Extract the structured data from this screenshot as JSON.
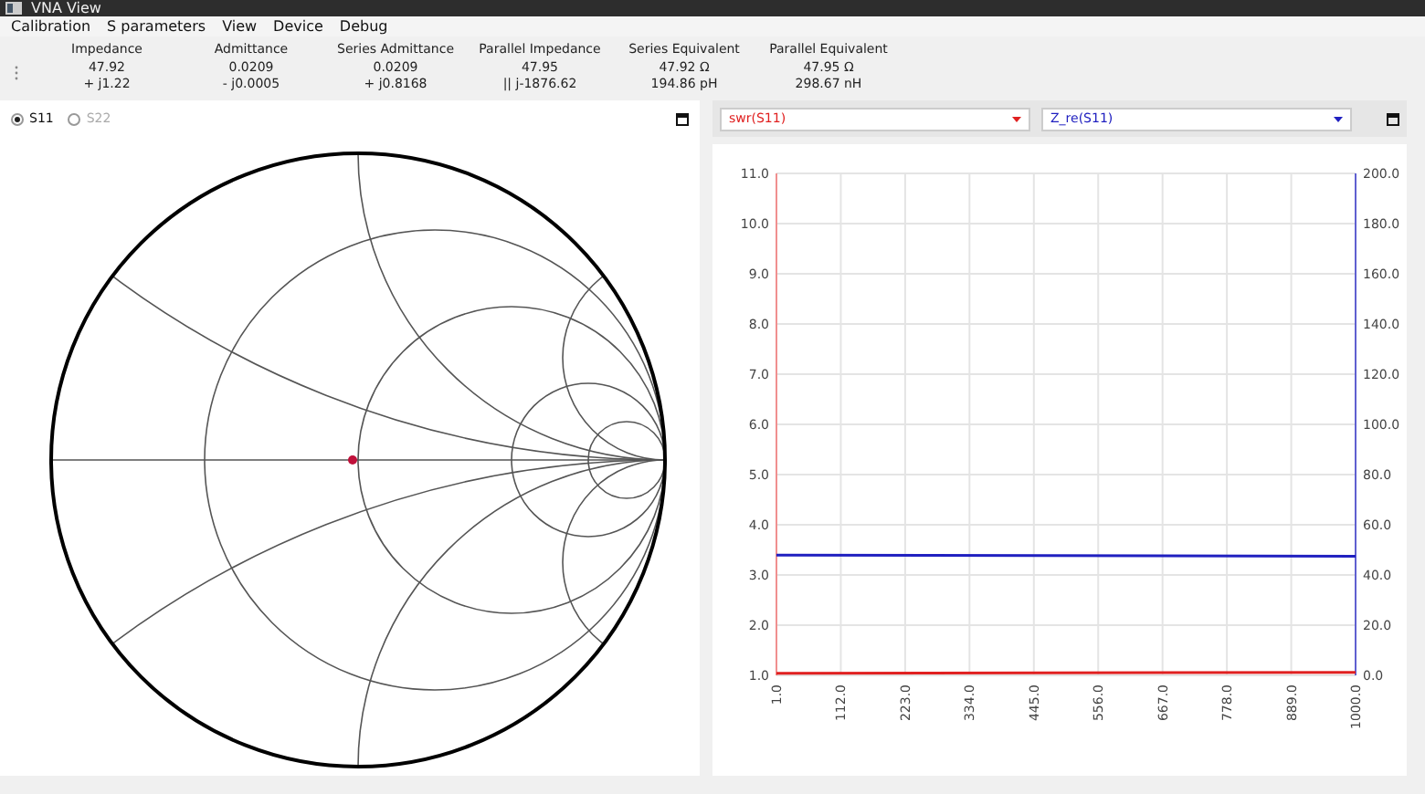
{
  "window": {
    "title": "VNA View"
  },
  "menu": [
    "Calibration",
    "S parameters",
    "View",
    "Device",
    "Debug"
  ],
  "readings": [
    {
      "label": "Impedance",
      "line1": "47.92",
      "line2": "+ j1.22"
    },
    {
      "label": "Admittance",
      "line1": "0.0209",
      "line2": "- j0.0005"
    },
    {
      "label": "Series Admittance",
      "line1": "0.0209",
      "line2": "+ j0.8168"
    },
    {
      "label": "Parallel Impedance",
      "line1": "47.95",
      "line2": "|| j-1876.62"
    },
    {
      "label": "Series Equivalent",
      "line1": "47.92 Ω",
      "line2": "194.86 pH"
    },
    {
      "label": "Parallel Equivalent",
      "line1": "47.95 Ω",
      "line2": "298.67 nH"
    }
  ],
  "smith": {
    "ports": [
      {
        "label": "S11",
        "selected": true
      },
      {
        "label": "S22",
        "selected": false
      }
    ]
  },
  "plot": {
    "right_axis_ticks": [
      "200.0",
      "180.0",
      "160.0",
      "140.0",
      "120.0",
      "100.0",
      "80.0",
      "60.0",
      "40.0",
      "20.0",
      "0.0"
    ],
    "chart_data": {
      "type": "line",
      "grid": true,
      "x": [
        1,
        1000
      ],
      "xlim": [
        1,
        1000
      ],
      "ylim": [
        1,
        11
      ],
      "xticks": [
        {
          "value": 1,
          "label": "1.0"
        },
        {
          "value": 112,
          "label": "112.0"
        },
        {
          "value": 223,
          "label": "223.0"
        },
        {
          "value": 334,
          "label": "334.0"
        },
        {
          "value": 445,
          "label": "445.0"
        },
        {
          "value": 556,
          "label": "556.0"
        },
        {
          "value": 667,
          "label": "667.0"
        },
        {
          "value": 778,
          "label": "778.0"
        },
        {
          "value": 889,
          "label": "889.0"
        },
        {
          "value": 1000,
          "label": "1000.0"
        }
      ],
      "yticks": [
        {
          "value": 1,
          "label": "1.0"
        },
        {
          "value": 2,
          "label": "2.0"
        },
        {
          "value": 3,
          "label": "3.0"
        },
        {
          "value": 4,
          "label": "4.0"
        },
        {
          "value": 5,
          "label": "5.0"
        },
        {
          "value": 6,
          "label": "6.0"
        },
        {
          "value": 7,
          "label": "7.0"
        },
        {
          "value": 8,
          "label": "8.0"
        },
        {
          "value": 9,
          "label": "9.0"
        },
        {
          "value": 10,
          "label": "10.0"
        },
        {
          "value": 11,
          "label": "11.0"
        }
      ],
      "series": [
        {
          "name": "swr(S11)",
          "color": "#e02020",
          "values": [
            1.04,
            1.06
          ]
        },
        {
          "name": "Z_re(S11)",
          "color": "#2020c0",
          "values": [
            3.395,
            3.375
          ]
        }
      ]
    }
  }
}
